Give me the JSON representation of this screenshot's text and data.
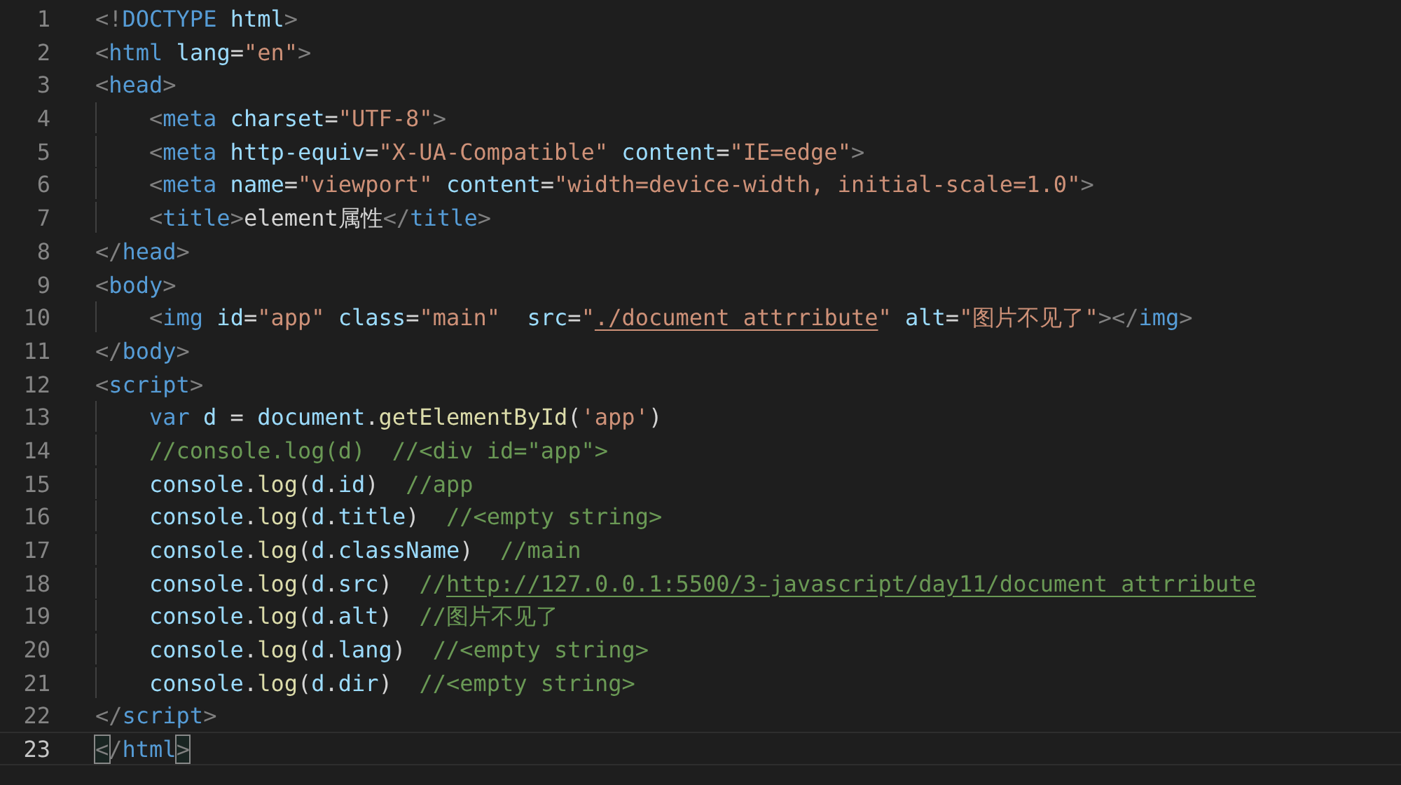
{
  "lines": [
    {
      "number": "1",
      "current": false,
      "indented": false,
      "tokens": [
        {
          "kind": "punct",
          "text": "<!"
        },
        {
          "kind": "tag",
          "text": "DOCTYPE"
        },
        {
          "kind": "attr",
          "text": " html"
        },
        {
          "kind": "punct",
          "text": ">"
        }
      ]
    },
    {
      "number": "2",
      "current": false,
      "indented": false,
      "tokens": [
        {
          "kind": "punct",
          "text": "<"
        },
        {
          "kind": "tag",
          "text": "html"
        },
        {
          "kind": "attr",
          "text": " lang"
        },
        {
          "kind": "text",
          "text": "="
        },
        {
          "kind": "string",
          "text": "\"en\""
        },
        {
          "kind": "punct",
          "text": ">"
        }
      ]
    },
    {
      "number": "3",
      "current": false,
      "indented": false,
      "tokens": [
        {
          "kind": "punct",
          "text": "<"
        },
        {
          "kind": "tag",
          "text": "head"
        },
        {
          "kind": "punct",
          "text": ">"
        }
      ]
    },
    {
      "number": "4",
      "current": false,
      "indented": true,
      "tokens": [
        {
          "kind": "punct",
          "text": "<"
        },
        {
          "kind": "tag",
          "text": "meta"
        },
        {
          "kind": "attr",
          "text": " charset"
        },
        {
          "kind": "text",
          "text": "="
        },
        {
          "kind": "string",
          "text": "\"UTF-8\""
        },
        {
          "kind": "punct",
          "text": ">"
        }
      ]
    },
    {
      "number": "5",
      "current": false,
      "indented": true,
      "tokens": [
        {
          "kind": "punct",
          "text": "<"
        },
        {
          "kind": "tag",
          "text": "meta"
        },
        {
          "kind": "attr",
          "text": " http-equiv"
        },
        {
          "kind": "text",
          "text": "="
        },
        {
          "kind": "string",
          "text": "\"X-UA-Compatible\""
        },
        {
          "kind": "attr",
          "text": " content"
        },
        {
          "kind": "text",
          "text": "="
        },
        {
          "kind": "string",
          "text": "\"IE=edge\""
        },
        {
          "kind": "punct",
          "text": ">"
        }
      ]
    },
    {
      "number": "6",
      "current": false,
      "indented": true,
      "tokens": [
        {
          "kind": "punct",
          "text": "<"
        },
        {
          "kind": "tag",
          "text": "meta"
        },
        {
          "kind": "attr",
          "text": " name"
        },
        {
          "kind": "text",
          "text": "="
        },
        {
          "kind": "string",
          "text": "\"viewport\""
        },
        {
          "kind": "attr",
          "text": " content"
        },
        {
          "kind": "text",
          "text": "="
        },
        {
          "kind": "string",
          "text": "\"width=device-width, initial-scale=1.0\""
        },
        {
          "kind": "punct",
          "text": ">"
        }
      ]
    },
    {
      "number": "7",
      "current": false,
      "indented": true,
      "tokens": [
        {
          "kind": "punct",
          "text": "<"
        },
        {
          "kind": "tag",
          "text": "title"
        },
        {
          "kind": "punct",
          "text": ">"
        },
        {
          "kind": "text",
          "text": "element属性"
        },
        {
          "kind": "punct",
          "text": "</"
        },
        {
          "kind": "tag",
          "text": "title"
        },
        {
          "kind": "punct",
          "text": ">"
        }
      ]
    },
    {
      "number": "8",
      "current": false,
      "indented": false,
      "tokens": [
        {
          "kind": "punct",
          "text": "</"
        },
        {
          "kind": "tag",
          "text": "head"
        },
        {
          "kind": "punct",
          "text": ">"
        }
      ]
    },
    {
      "number": "9",
      "current": false,
      "indented": false,
      "tokens": [
        {
          "kind": "punct",
          "text": "<"
        },
        {
          "kind": "tag",
          "text": "body"
        },
        {
          "kind": "punct",
          "text": ">"
        }
      ]
    },
    {
      "number": "10",
      "current": false,
      "indented": true,
      "tokens": [
        {
          "kind": "punct",
          "text": "<"
        },
        {
          "kind": "tag",
          "text": "img"
        },
        {
          "kind": "attr",
          "text": " id"
        },
        {
          "kind": "text",
          "text": "="
        },
        {
          "kind": "string",
          "text": "\"app\""
        },
        {
          "kind": "attr",
          "text": " class"
        },
        {
          "kind": "text",
          "text": "="
        },
        {
          "kind": "string",
          "text": "\"main\""
        },
        {
          "kind": "attr",
          "text": "  src"
        },
        {
          "kind": "text",
          "text": "="
        },
        {
          "kind": "string",
          "text": "\""
        },
        {
          "kind": "link",
          "text": "./document_attrribute"
        },
        {
          "kind": "string",
          "text": "\""
        },
        {
          "kind": "attr",
          "text": " alt"
        },
        {
          "kind": "text",
          "text": "="
        },
        {
          "kind": "string",
          "text": "\"图片不见了\""
        },
        {
          "kind": "punct",
          "text": "></"
        },
        {
          "kind": "tag",
          "text": "img"
        },
        {
          "kind": "punct",
          "text": ">"
        }
      ]
    },
    {
      "number": "11",
      "current": false,
      "indented": false,
      "tokens": [
        {
          "kind": "punct",
          "text": "</"
        },
        {
          "kind": "tag",
          "text": "body"
        },
        {
          "kind": "punct",
          "text": ">"
        }
      ]
    },
    {
      "number": "12",
      "current": false,
      "indented": false,
      "tokens": [
        {
          "kind": "punct",
          "text": "<"
        },
        {
          "kind": "tag",
          "text": "script"
        },
        {
          "kind": "punct",
          "text": ">"
        }
      ]
    },
    {
      "number": "13",
      "current": false,
      "indented": true,
      "tokens": [
        {
          "kind": "tag",
          "text": "var"
        },
        {
          "kind": "attr",
          "text": " d"
        },
        {
          "kind": "text",
          "text": " = "
        },
        {
          "kind": "attr",
          "text": "document"
        },
        {
          "kind": "text",
          "text": "."
        },
        {
          "kind": "func",
          "text": "getElementById"
        },
        {
          "kind": "text",
          "text": "("
        },
        {
          "kind": "string",
          "text": "'app'"
        },
        {
          "kind": "text",
          "text": ")"
        }
      ]
    },
    {
      "number": "14",
      "current": false,
      "indented": true,
      "tokens": [
        {
          "kind": "comment",
          "text": "//console.log(d)  //<div id=\"app\">"
        }
      ]
    },
    {
      "number": "15",
      "current": false,
      "indented": true,
      "tokens": [
        {
          "kind": "attr",
          "text": "console"
        },
        {
          "kind": "text",
          "text": "."
        },
        {
          "kind": "func",
          "text": "log"
        },
        {
          "kind": "text",
          "text": "("
        },
        {
          "kind": "attr",
          "text": "d"
        },
        {
          "kind": "text",
          "text": "."
        },
        {
          "kind": "attr",
          "text": "id"
        },
        {
          "kind": "text",
          "text": ")  "
        },
        {
          "kind": "comment",
          "text": "//app"
        }
      ]
    },
    {
      "number": "16",
      "current": false,
      "indented": true,
      "tokens": [
        {
          "kind": "attr",
          "text": "console"
        },
        {
          "kind": "text",
          "text": "."
        },
        {
          "kind": "func",
          "text": "log"
        },
        {
          "kind": "text",
          "text": "("
        },
        {
          "kind": "attr",
          "text": "d"
        },
        {
          "kind": "text",
          "text": "."
        },
        {
          "kind": "attr",
          "text": "title"
        },
        {
          "kind": "text",
          "text": ")  "
        },
        {
          "kind": "comment",
          "text": "//<empty string>"
        }
      ]
    },
    {
      "number": "17",
      "current": false,
      "indented": true,
      "tokens": [
        {
          "kind": "attr",
          "text": "console"
        },
        {
          "kind": "text",
          "text": "."
        },
        {
          "kind": "func",
          "text": "log"
        },
        {
          "kind": "text",
          "text": "("
        },
        {
          "kind": "attr",
          "text": "d"
        },
        {
          "kind": "text",
          "text": "."
        },
        {
          "kind": "attr",
          "text": "className"
        },
        {
          "kind": "text",
          "text": ")  "
        },
        {
          "kind": "comment",
          "text": "//main"
        }
      ]
    },
    {
      "number": "18",
      "current": false,
      "indented": true,
      "tokens": [
        {
          "kind": "attr",
          "text": "console"
        },
        {
          "kind": "text",
          "text": "."
        },
        {
          "kind": "func",
          "text": "log"
        },
        {
          "kind": "text",
          "text": "("
        },
        {
          "kind": "attr",
          "text": "d"
        },
        {
          "kind": "text",
          "text": "."
        },
        {
          "kind": "attr",
          "text": "src"
        },
        {
          "kind": "text",
          "text": ")  "
        },
        {
          "kind": "comment",
          "text": "//"
        },
        {
          "kind": "comment-link",
          "text": "http://127.0.0.1:5500/3-javascript/day11/document_attrribute"
        }
      ]
    },
    {
      "number": "19",
      "current": false,
      "indented": true,
      "tokens": [
        {
          "kind": "attr",
          "text": "console"
        },
        {
          "kind": "text",
          "text": "."
        },
        {
          "kind": "func",
          "text": "log"
        },
        {
          "kind": "text",
          "text": "("
        },
        {
          "kind": "attr",
          "text": "d"
        },
        {
          "kind": "text",
          "text": "."
        },
        {
          "kind": "attr",
          "text": "alt"
        },
        {
          "kind": "text",
          "text": ")  "
        },
        {
          "kind": "comment",
          "text": "//图片不见了"
        }
      ]
    },
    {
      "number": "20",
      "current": false,
      "indented": true,
      "tokens": [
        {
          "kind": "attr",
          "text": "console"
        },
        {
          "kind": "text",
          "text": "."
        },
        {
          "kind": "func",
          "text": "log"
        },
        {
          "kind": "text",
          "text": "("
        },
        {
          "kind": "attr",
          "text": "d"
        },
        {
          "kind": "text",
          "text": "."
        },
        {
          "kind": "attr",
          "text": "lang"
        },
        {
          "kind": "text",
          "text": ")  "
        },
        {
          "kind": "comment",
          "text": "//<empty string>"
        }
      ]
    },
    {
      "number": "21",
      "current": false,
      "indented": true,
      "tokens": [
        {
          "kind": "attr",
          "text": "console"
        },
        {
          "kind": "text",
          "text": "."
        },
        {
          "kind": "func",
          "text": "log"
        },
        {
          "kind": "text",
          "text": "("
        },
        {
          "kind": "attr",
          "text": "d"
        },
        {
          "kind": "text",
          "text": "."
        },
        {
          "kind": "attr",
          "text": "dir"
        },
        {
          "kind": "text",
          "text": ")  "
        },
        {
          "kind": "comment",
          "text": "//<empty string>"
        }
      ]
    },
    {
      "number": "22",
      "current": false,
      "indented": false,
      "tokens": [
        {
          "kind": "punct",
          "text": "</"
        },
        {
          "kind": "tag",
          "text": "script"
        },
        {
          "kind": "punct",
          "text": ">"
        }
      ]
    },
    {
      "number": "23",
      "current": true,
      "indented": false,
      "tokens": [
        {
          "kind": "punct",
          "text": "<",
          "matched": true
        },
        {
          "kind": "punct",
          "text": "/",
          "matched": false
        },
        {
          "kind": "tag",
          "text": "html"
        },
        {
          "kind": "punct",
          "text": ">",
          "matched": true
        }
      ]
    }
  ]
}
